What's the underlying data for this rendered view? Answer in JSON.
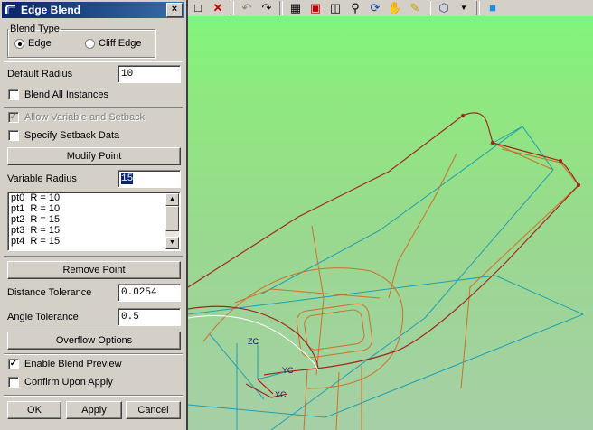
{
  "dialog": {
    "title": "Edge Blend",
    "close_glyph": "×",
    "blend_type": {
      "legend": "Blend Type",
      "options": [
        {
          "label": "Edge",
          "selected": true
        },
        {
          "label": "Cliff Edge",
          "selected": false
        }
      ]
    },
    "default_radius": {
      "label": "Default Radius",
      "value": "10"
    },
    "blend_all_instances": {
      "label": "Blend All Instances",
      "checked": false
    },
    "allow_variable": {
      "label": "Allow Variable and Setback",
      "checked": true,
      "disabled": true
    },
    "specify_setback": {
      "label": "Specify Setback Data",
      "checked": false
    },
    "modify_point_label": "Modify Point",
    "variable_radius": {
      "label": "Variable Radius",
      "value": "15"
    },
    "points": [
      "pt0  R = 10",
      "pt1  R = 10",
      "pt2  R = 15",
      "pt3  R = 15",
      "pt4  R = 15"
    ],
    "remove_point_label": "Remove Point",
    "distance_tolerance": {
      "label": "Distance Tolerance",
      "value": "0.0254"
    },
    "angle_tolerance": {
      "label": "Angle Tolerance",
      "value": "0.5"
    },
    "overflow_options_label": "Overflow Options",
    "enable_blend_preview": {
      "label": "Enable Blend Preview",
      "checked": true
    },
    "confirm_upon_apply": {
      "label": "Confirm Upon Apply",
      "checked": false
    },
    "buttons": {
      "ok": "OK",
      "apply": "Apply",
      "cancel": "Cancel"
    }
  },
  "toolbar": {
    "icons": [
      "page-icon",
      "delete-x-icon",
      "undo-icon",
      "redo-icon",
      "fit-view-icon",
      "zoom-window-icon",
      "zoom-fit-icon",
      "magnifier-icon",
      "rotate-icon",
      "pan-hand-icon",
      "note-icon",
      "wireframe-cube-icon",
      "shaded-cube-icon"
    ]
  },
  "viewport": {
    "axis_labels": {
      "zc": "ZC",
      "yc": "YC",
      "xc": "XC"
    },
    "colors": {
      "top_bg": "#7ff57a",
      "bottom_bg": "#a6cfa6",
      "edge_red": "#b0302a",
      "edge_cyan": "#1fa0b0",
      "edge_orange": "#d0702a"
    }
  }
}
